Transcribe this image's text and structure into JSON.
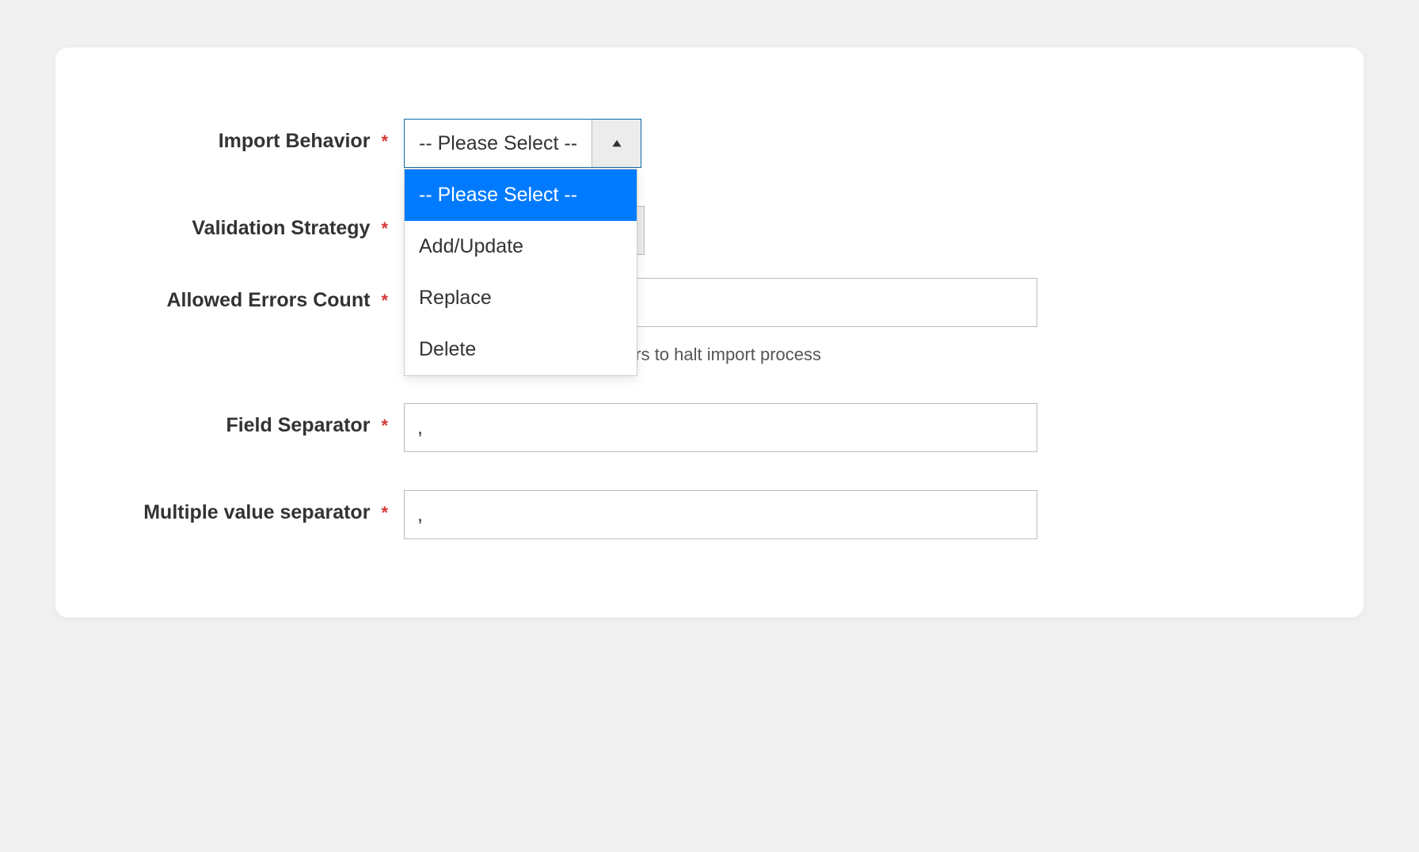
{
  "form": {
    "importBehavior": {
      "label": "Import Behavior",
      "selected": "-- Please Select --",
      "options": [
        "-- Please Select --",
        "Add/Update",
        "Replace",
        "Delete"
      ]
    },
    "validationStrategy": {
      "label": "Validation Strategy"
    },
    "allowedErrors": {
      "label": "Allowed Errors Count",
      "value": "",
      "helper": "Please specify number of errors to halt import process"
    },
    "fieldSeparator": {
      "label": "Field Separator",
      "value": ","
    },
    "multipleValueSeparator": {
      "label": "Multiple value separator",
      "value": ","
    }
  }
}
